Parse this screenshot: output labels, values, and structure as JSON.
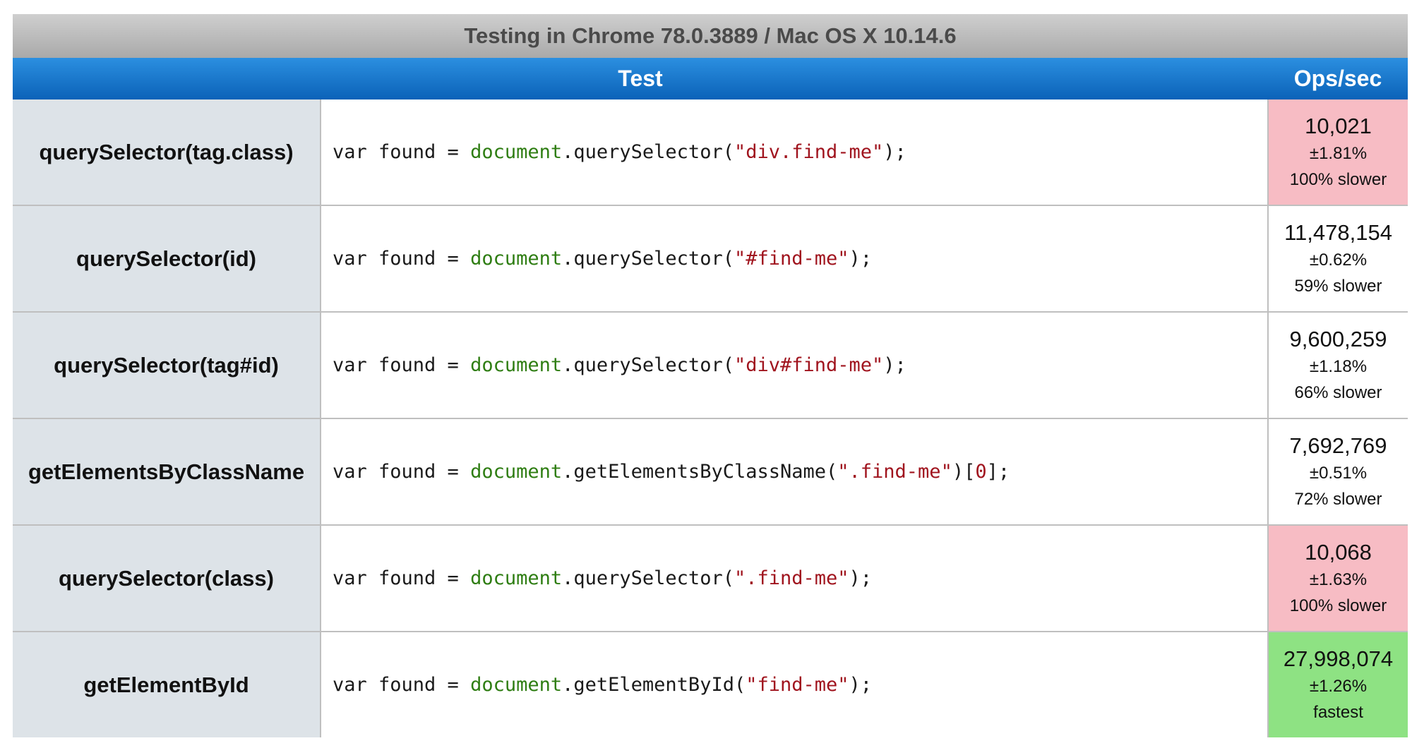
{
  "caption": "Testing in Chrome 78.0.3889 / Mac OS X 10.14.6",
  "headers": {
    "test": "Test",
    "ops": "Ops/sec"
  },
  "code_common": {
    "prefix": "var found = ",
    "object": "document"
  },
  "rows": [
    {
      "name": "querySelector(tag.class)",
      "method": ".querySelector(",
      "arg": "\"div.find-me\"",
      "suffix": ");",
      "index_open": "",
      "index": "",
      "index_close": "",
      "ops": "10,021",
      "error": "±1.81%",
      "relative": "100% slower",
      "status": "slow"
    },
    {
      "name": "querySelector(id)",
      "method": ".querySelector(",
      "arg": "\"#find-me\"",
      "suffix": ");",
      "index_open": "",
      "index": "",
      "index_close": "",
      "ops": "11,478,154",
      "error": "±0.62%",
      "relative": "59% slower",
      "status": "normal"
    },
    {
      "name": "querySelector(tag#id)",
      "method": ".querySelector(",
      "arg": "\"div#find-me\"",
      "suffix": ");",
      "index_open": "",
      "index": "",
      "index_close": "",
      "ops": "9,600,259",
      "error": "±1.18%",
      "relative": "66% slower",
      "status": "normal"
    },
    {
      "name": "getElementsByClassName",
      "method": ".getElementsByClassName(",
      "arg": "\".find-me\"",
      "suffix": ")",
      "index_open": "[",
      "index": "0",
      "index_close": "];",
      "ops": "7,692,769",
      "error": "±0.51%",
      "relative": "72% slower",
      "status": "normal"
    },
    {
      "name": "querySelector(class)",
      "method": ".querySelector(",
      "arg": "\".find-me\"",
      "suffix": ");",
      "index_open": "",
      "index": "",
      "index_close": "",
      "ops": "10,068",
      "error": "±1.63%",
      "relative": "100% slower",
      "status": "slow"
    },
    {
      "name": "getElementById",
      "method": ".getElementById(",
      "arg": "\"find-me\"",
      "suffix": ");",
      "index_open": "",
      "index": "",
      "index_close": "",
      "ops": "27,998,074",
      "error": "±1.26%",
      "relative": "fastest",
      "status": "fast"
    }
  ]
}
